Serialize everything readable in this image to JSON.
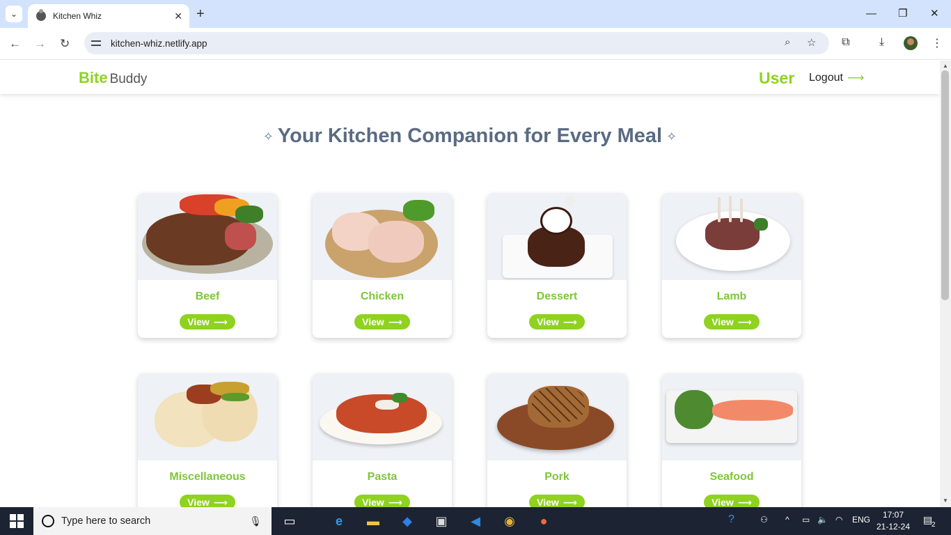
{
  "browser": {
    "tab_title": "Kitchen Whiz",
    "url": "kitchen-whiz.netlify.app"
  },
  "header": {
    "logo_bold": "Bite",
    "logo_regular": "Buddy",
    "user_label": "User",
    "logout_label": "Logout"
  },
  "hero": {
    "title": "Your Kitchen Companion for Every Meal"
  },
  "categories": [
    {
      "name": "Beef",
      "button": "View"
    },
    {
      "name": "Chicken",
      "button": "View"
    },
    {
      "name": "Dessert",
      "button": "View"
    },
    {
      "name": "Lamb",
      "button": "View"
    },
    {
      "name": "Miscellaneous",
      "button": "View"
    },
    {
      "name": "Pasta",
      "button": "View"
    },
    {
      "name": "Pork",
      "button": "View"
    },
    {
      "name": "Seafood",
      "button": "View"
    }
  ],
  "taskbar": {
    "search_placeholder": "Type here to search",
    "language": "ENG",
    "time": "17:07",
    "date": "21-12-24",
    "notification_count": "2"
  },
  "colors": {
    "accent": "#8fd21f",
    "hero_text": "#5a6b82"
  }
}
